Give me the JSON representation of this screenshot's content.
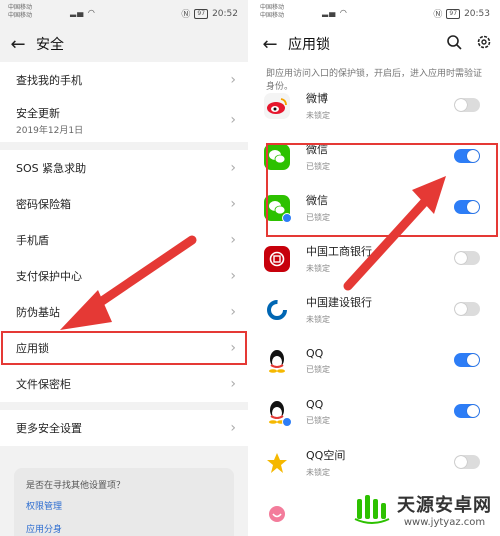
{
  "left": {
    "status": {
      "carrier1": "中国移动",
      "carrier2": "中国移动",
      "net": "4G 4G",
      "time": "20:52",
      "battery": "97"
    },
    "title": "安全",
    "items": [
      {
        "label": "查找我的手机"
      },
      {
        "label": "安全更新",
        "sub": "2019年12月1日"
      },
      {
        "label": "SOS 紧急求助"
      },
      {
        "label": "密码保险箱"
      },
      {
        "label": "手机盾"
      },
      {
        "label": "支付保护中心"
      },
      {
        "label": "防伪基站"
      },
      {
        "label": "应用锁"
      },
      {
        "label": "文件保密柜"
      },
      {
        "label": "更多安全设置"
      }
    ],
    "hint": {
      "question": "是否在寻找其他设置项？",
      "link1": "权限管理",
      "link2": "应用分身"
    }
  },
  "right": {
    "status": {
      "carrier1": "中国移动",
      "carrier2": "中国移动",
      "net": "4G 4G",
      "time": "20:53",
      "battery": "97"
    },
    "title": "应用锁",
    "description": "即应用访问入口的保护锁，开启后，进入应用时需验证身份。",
    "apps": [
      {
        "name": "微博",
        "status": "未锁定",
        "on": false,
        "color": "#f4f4f4",
        "icon": "weibo-icon",
        "twin": false
      },
      {
        "name": "微信",
        "status": "已锁定",
        "on": true,
        "color": "#2dc100",
        "icon": "wechat-icon",
        "twin": false
      },
      {
        "name": "微信",
        "status": "已锁定",
        "on": true,
        "color": "#2dc100",
        "icon": "wechat-icon",
        "twin": true
      },
      {
        "name": "中国工商银行",
        "status": "未锁定",
        "on": false,
        "color": "#c7000b",
        "icon": "icbc-icon",
        "twin": false
      },
      {
        "name": "中国建设银行",
        "status": "未锁定",
        "on": false,
        "color": "#ffffff",
        "icon": "ccb-icon",
        "twin": false
      },
      {
        "name": "QQ",
        "status": "已锁定",
        "on": true,
        "color": "#ffffff",
        "icon": "qq-icon",
        "twin": false
      },
      {
        "name": "QQ",
        "status": "已锁定",
        "on": true,
        "color": "#ffffff",
        "icon": "qq-icon",
        "twin": true
      },
      {
        "name": "QQ空间",
        "status": "未锁定",
        "on": false,
        "color": "#ffffff",
        "icon": "qzone-icon",
        "twin": false
      },
      {
        "name": "",
        "status": "",
        "on": false,
        "color": "#ffffff",
        "icon": "app-icon",
        "twin": false
      }
    ]
  },
  "watermark": {
    "title": "天源安卓网",
    "url": "www.jytyaz.com"
  },
  "colors": {
    "accent": "#2d7df6",
    "highlight": "#e53935",
    "link": "#2d6dd0"
  }
}
